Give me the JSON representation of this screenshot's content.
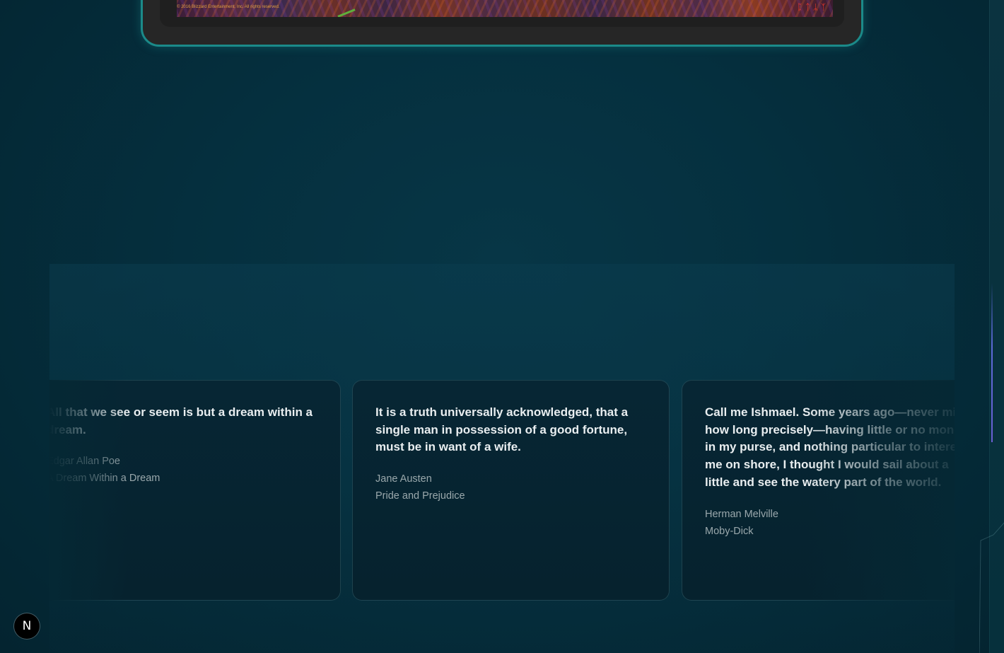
{
  "hero": {
    "copyright": "© 2016 Blizzard Entertainment, Inc. All rights reserved.",
    "corner_mark": "ᛈ ᛏ ᛦ ᛉ",
    "image_icon": "artwork-image"
  },
  "quotes": [
    {
      "text": "All that we see or seem is but a dream within a dream.",
      "author": "Edgar Allan Poe",
      "source": "A Dream Within a Dream"
    },
    {
      "text": "It is a truth universally acknowledged, that a single man in possession of a good fortune, must be in want of a wife.",
      "author": "Jane Austen",
      "source": "Pride and Prejudice"
    },
    {
      "text": "Call me Ishmael. Some years ago—never mind how long precisely—having little or no money in my purse, and nothing particular to interest me on shore, I thought I would sail about a little and see the watery part of the world.",
      "author": "Herman Melville",
      "source": "Moby-Dick"
    }
  ],
  "badge": {
    "label": "N",
    "icon": "nextjs-logo-icon"
  },
  "colors": {
    "background": "#062a35",
    "frame_border": "#1b8a89",
    "card_border": "rgba(120,180,190,0.22)",
    "quote_text": "#e9eef0",
    "meta_text": "#9aa8ac",
    "rail_accent": "#5c6ad8"
  }
}
